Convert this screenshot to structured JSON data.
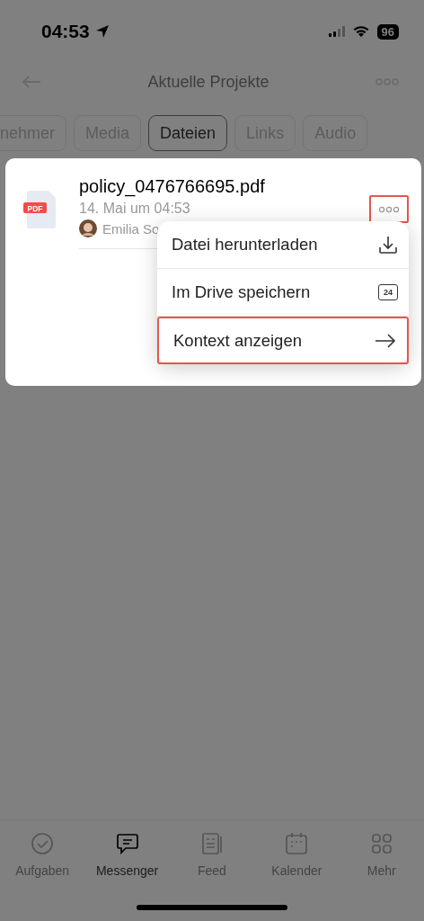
{
  "status_bar": {
    "time": "04:53",
    "battery": "96"
  },
  "header": {
    "title": "Aktuelle Projekte"
  },
  "tabs": [
    {
      "label": "nehmer",
      "selected": false
    },
    {
      "label": "Media",
      "selected": false
    },
    {
      "label": "Dateien",
      "selected": true
    },
    {
      "label": "Links",
      "selected": false
    },
    {
      "label": "Audio",
      "selected": false
    }
  ],
  "file": {
    "badge": "PDF",
    "name": "policy_0476766695.pdf",
    "date": "14. Mai um 04:53",
    "author": "Emilia So",
    "more_highlighted": true
  },
  "menu": [
    {
      "label": "Datei herunterladen",
      "kind": "download",
      "highlighted": false
    },
    {
      "label": "Im Drive speichern",
      "kind": "drive",
      "icon_text": "24",
      "highlighted": false
    },
    {
      "label": "Kontext anzeigen",
      "kind": "arrow",
      "highlighted": true
    }
  ],
  "bottom_nav": [
    {
      "label": "Aufgaben",
      "kind": "check",
      "selected": false
    },
    {
      "label": "Messenger",
      "kind": "chat",
      "selected": true
    },
    {
      "label": "Feed",
      "kind": "feed",
      "selected": false
    },
    {
      "label": "Kalender",
      "kind": "calendar",
      "selected": false
    },
    {
      "label": "Mehr",
      "kind": "grid",
      "selected": false
    }
  ]
}
